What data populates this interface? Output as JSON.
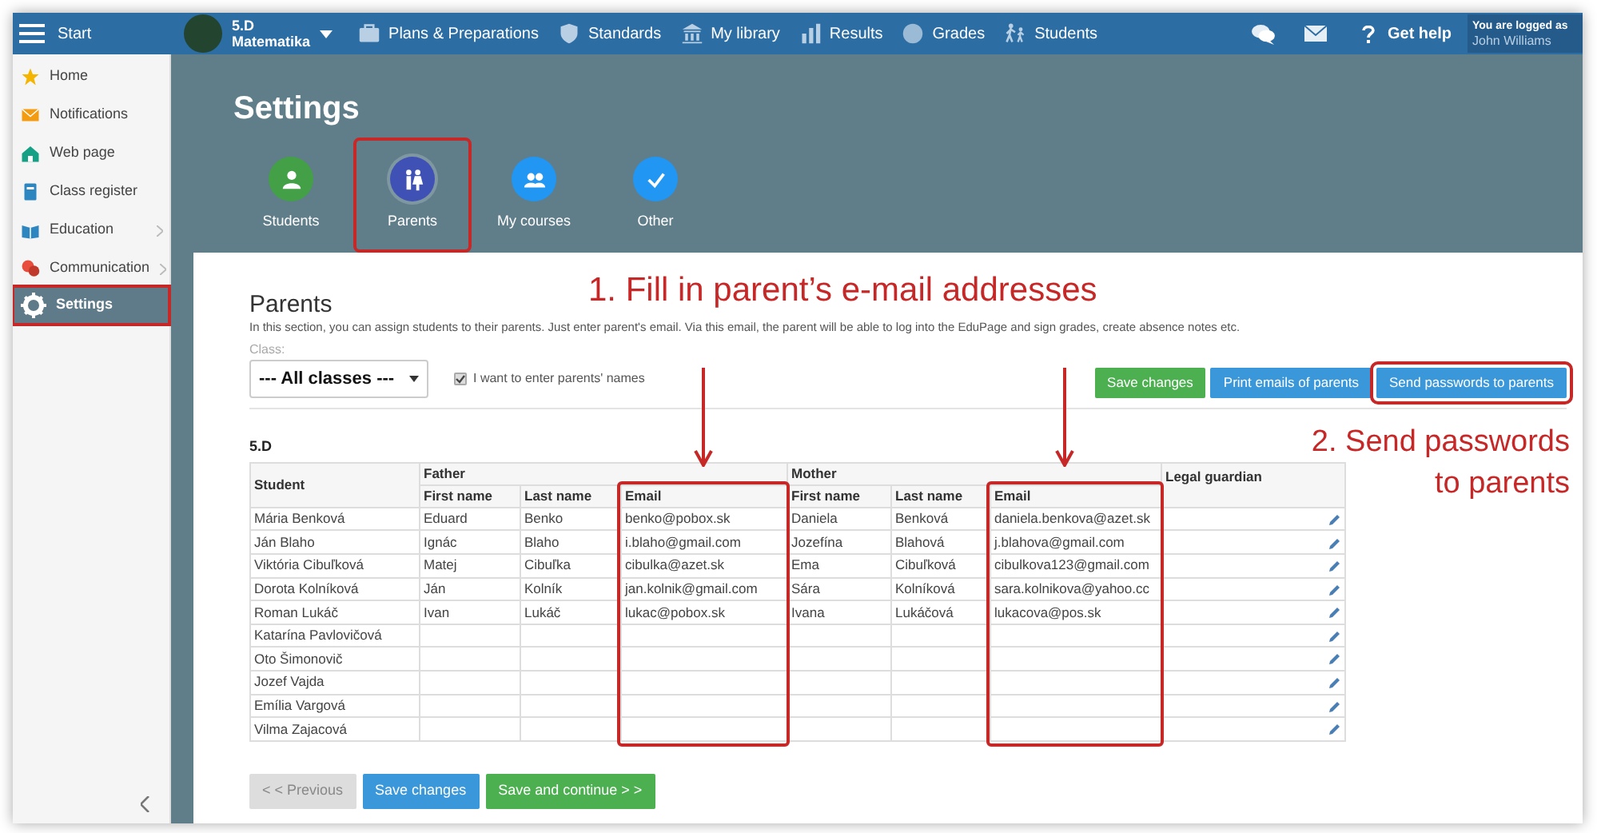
{
  "top_bar": {
    "start": "Start",
    "class_name": "5.D",
    "subject": "Matematika",
    "nav": [
      {
        "label": "Plans & Preparations",
        "kind": "briefcase"
      },
      {
        "label": "Standards",
        "kind": "shield"
      },
      {
        "label": "My library",
        "kind": "library"
      },
      {
        "label": "Results",
        "kind": "chart"
      },
      {
        "label": "Grades",
        "kind": "grades"
      },
      {
        "label": "Students",
        "kind": "walkers"
      }
    ],
    "help": "Get help",
    "logged_label": "You are logged as",
    "user": "John Williams"
  },
  "sidebar": {
    "items": [
      {
        "label": "Home",
        "kind": "star",
        "selected": false,
        "expandable": false,
        "highlighted": false
      },
      {
        "label": "Notifications",
        "kind": "mail",
        "selected": false,
        "expandable": false,
        "highlighted": false
      },
      {
        "label": "Web page",
        "kind": "house",
        "selected": false,
        "expandable": false,
        "highlighted": false
      },
      {
        "label": "Class register",
        "kind": "book",
        "selected": false,
        "expandable": false,
        "highlighted": false
      },
      {
        "label": "Education",
        "kind": "openbook",
        "selected": false,
        "expandable": true,
        "highlighted": false
      },
      {
        "label": "Communication",
        "kind": "chat",
        "selected": false,
        "expandable": true,
        "highlighted": false
      },
      {
        "label": "Settings",
        "kind": "gear",
        "selected": true,
        "expandable": false,
        "highlighted": true
      }
    ]
  },
  "header": {
    "title": "Settings",
    "tabs": [
      {
        "label": "Students",
        "kind": "person",
        "color": "#43a047",
        "selected": false,
        "highlighted": false
      },
      {
        "label": "Parents",
        "kind": "parents",
        "color": "#3f51b5",
        "selected": true,
        "highlighted": true
      },
      {
        "label": "My courses",
        "kind": "group",
        "color": "#2196f3",
        "selected": false,
        "highlighted": false
      },
      {
        "label": "Other",
        "kind": "check",
        "color": "#2196f3",
        "selected": false,
        "highlighted": false
      }
    ]
  },
  "section": {
    "title": "Parents",
    "description": "In this section, you can assign students to their parents. Just enter parent's email. Via this email, the parent will be able to log into the EduPage and sign grades, create absence notes etc.",
    "class_label": "Class:",
    "class_value": "--- All classes ---",
    "names_checkbox": {
      "label": "I want to enter parents' names",
      "checked": true
    },
    "actions": [
      {
        "label": "Save changes",
        "kind": "success",
        "highlighted": false
      },
      {
        "label": "Print emails of parents",
        "kind": "primary",
        "highlighted": false
      },
      {
        "label": "Send passwords to parents",
        "kind": "primary",
        "highlighted": true
      }
    ]
  },
  "table": {
    "caption": "5.D",
    "student_header": "Student",
    "guardian_header": "Legal guardian",
    "groups": [
      {
        "label": "Father",
        "columns": [
          {
            "label": "First name",
            "highlighted": false
          },
          {
            "label": "Last name",
            "highlighted": false
          },
          {
            "label": "Email",
            "highlighted": true
          }
        ]
      },
      {
        "label": "Mother",
        "columns": [
          {
            "label": "First name",
            "highlighted": false
          },
          {
            "label": "Last name",
            "highlighted": false
          },
          {
            "label": "Email",
            "highlighted": true
          }
        ]
      }
    ],
    "rows": [
      {
        "student": "Mária Benková",
        "father": [
          "Eduard",
          "Benko",
          "benko@pobox.sk"
        ],
        "mother": [
          "Daniela",
          "Benková",
          "daniela.benkova@azet.sk"
        ]
      },
      {
        "student": "Ján Blaho",
        "father": [
          "Ignác",
          "Blaho",
          "i.blaho@gmail.com"
        ],
        "mother": [
          "Jozefína",
          "Blahová",
          "j.blahova@gmail.com"
        ]
      },
      {
        "student": "Viktória Cibuľková",
        "father": [
          "Matej",
          "Cibuľka",
          "cibulka@azet.sk"
        ],
        "mother": [
          "Ema",
          "Cibuľková",
          "cibulkova123@gmail.com"
        ]
      },
      {
        "student": "Dorota Kolníková",
        "father": [
          "Ján",
          "Kolník",
          "jan.kolnik@gmail.com"
        ],
        "mother": [
          "Sára",
          "Kolníková",
          "sara.kolnikova@yahoo.cc"
        ]
      },
      {
        "student": "Roman Lukáč",
        "father": [
          "Ivan",
          "Lukáč",
          "lukac@pobox.sk"
        ],
        "mother": [
          "Ivana",
          "Lukáčová",
          "lukacova@pos.sk"
        ]
      },
      {
        "student": "Katarína Pavlovičová"
      },
      {
        "student": "Oto Šimonovič"
      },
      {
        "student": "Jozef Vajda"
      },
      {
        "student": "Emília Vargová"
      },
      {
        "student": "Vilma Zajacová"
      }
    ]
  },
  "footer_buttons": [
    {
      "label": "< < Previous",
      "kind": "default",
      "disabled": true
    },
    {
      "label": "Save changes",
      "kind": "primary",
      "disabled": false
    },
    {
      "label": "Save and continue > >",
      "kind": "success",
      "disabled": false
    }
  ],
  "annotations": [
    {
      "text": "1. Fill in parent’s e-mail addresses"
    },
    {
      "text": "2. Send passwords to parents"
    }
  ]
}
